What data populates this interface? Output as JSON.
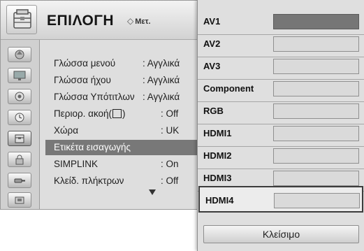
{
  "header": {
    "title": "ΕΠΙΛΟΓΗ",
    "move_hint": "Μετ.",
    "icon": "option-icon"
  },
  "sidebar": {
    "icons": [
      "picture-icon",
      "screen-icon",
      "audio-icon",
      "clock-icon",
      "option-icon",
      "lock-icon",
      "input-icon",
      "usb-icon"
    ],
    "active_index": 4
  },
  "menu": {
    "items": [
      {
        "label": "Γλώσσα μενού",
        "value": ": Αγγλικά"
      },
      {
        "label": "Γλώσσα ήχου",
        "value": ": Αγγλικά"
      },
      {
        "label": "Γλώσσα Υπότιτλων",
        "value": ": Αγγλικά"
      },
      {
        "label": "Περιορ. ακοή(",
        "label_icon": "hearing-impaired-icon",
        "label_suffix": ")",
        "value": ": Off"
      },
      {
        "label": "Χώρα",
        "value": ": UK"
      },
      {
        "label": "Ετικέτα εισαγωγής",
        "value": ""
      },
      {
        "label": "SIMPLINK",
        "value": ": On"
      },
      {
        "label": "Κλείδ. πλήκτρων",
        "value": ": Off"
      }
    ],
    "selected_index": 5,
    "scroll_icon": "scroll-down-arrow-icon"
  },
  "input_list": {
    "items": [
      {
        "name": "AV1",
        "label_value": ""
      },
      {
        "name": "AV2",
        "label_value": ""
      },
      {
        "name": "AV3",
        "label_value": ""
      },
      {
        "name": "Component",
        "label_value": ""
      },
      {
        "name": "RGB",
        "label_value": ""
      },
      {
        "name": "HDMI1",
        "label_value": ""
      },
      {
        "name": "HDMI2",
        "label_value": ""
      },
      {
        "name": "HDMI3",
        "label_value": ""
      },
      {
        "name": "HDMI4",
        "label_value": ""
      }
    ],
    "filled_index": 0,
    "highlighted_index": 8,
    "close_label": "Κλείσιμο"
  },
  "colors": {
    "selected_row": "#787878",
    "filled_box": "#767676",
    "panel_bg": "#dedede"
  }
}
